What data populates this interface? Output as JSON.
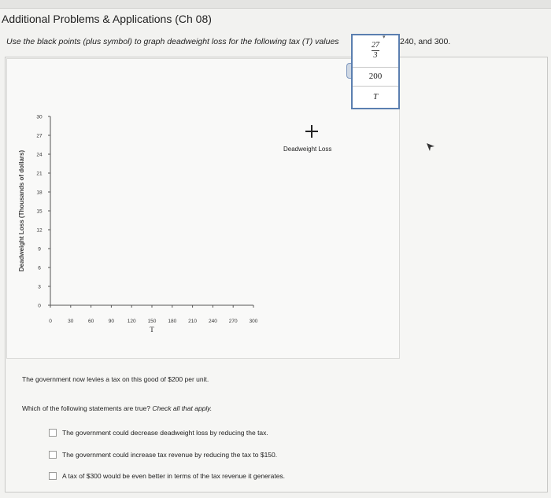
{
  "header": {
    "title": "Additional Problems & Applications (Ch 08)",
    "instruction_main": "Use the black points (plus symbol) to graph deadweight loss for the following tax (T) values",
    "instruction_tail": "240, and 300."
  },
  "popup": {
    "frac_num": "27",
    "frac_den": "3",
    "value": "200",
    "var_label": "T"
  },
  "tool": {
    "label": "Deadweight Loss",
    "icon": "plus-icon"
  },
  "question": {
    "text": "The government now levies a tax on this good of $200 per unit.",
    "prompt": "Which of the following statements are true?",
    "prompt_hint": "Check all that apply.",
    "options": [
      "The government could decrease deadweight loss by reducing the tax.",
      "The government could increase tax revenue by reducing the tax to $150.",
      "A tax of $300 would be even better in terms of the tax revenue it generates."
    ]
  },
  "chart_data": {
    "type": "scatter",
    "title": "",
    "xlabel": "T",
    "ylabel": "Deadweight Loss (Thousands of dollars)",
    "xlim": [
      0,
      300
    ],
    "ylim": [
      0,
      30
    ],
    "x_ticks": [
      0,
      30,
      60,
      90,
      120,
      150,
      180,
      210,
      240,
      270,
      300
    ],
    "y_ticks": [
      0,
      3,
      6,
      9,
      12,
      15,
      18,
      21,
      24,
      27,
      30
    ],
    "series": [],
    "grid": false
  },
  "colors": {
    "popup_border": "#5b7fb0",
    "text": "#222222",
    "panel_bg": "#f6f6f4"
  }
}
